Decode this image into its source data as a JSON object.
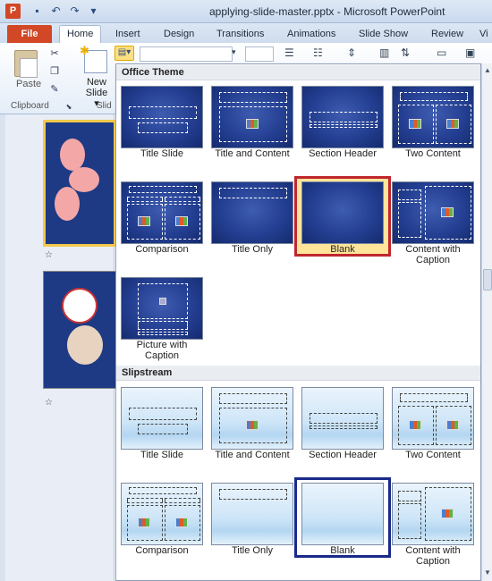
{
  "window": {
    "title": "applying-slide-master.pptx - Microsoft PowerPoint",
    "app_icon": "P"
  },
  "ribbon": {
    "file_tab": "File",
    "tabs": [
      "Home",
      "Insert",
      "Design",
      "Transitions",
      "Animations",
      "Slide Show",
      "Review",
      "Vi"
    ],
    "paste_label": "Paste",
    "new_slide_label_1": "New",
    "new_slide_label_2": "Slide ▾",
    "clipboard_group": "Clipboard",
    "slides_group": "Slid"
  },
  "gallery": {
    "sections": [
      {
        "title": "Office Theme",
        "theme": "office",
        "layouts": [
          {
            "label": "Title Slide",
            "label2": ""
          },
          {
            "label": "Title and Content",
            "label2": ""
          },
          {
            "label": "Section Header",
            "label2": ""
          },
          {
            "label": "Two Content",
            "label2": ""
          },
          {
            "label": "Comparison",
            "label2": ""
          },
          {
            "label": "Title Only",
            "label2": ""
          },
          {
            "label": "Blank",
            "label2": ""
          },
          {
            "label": "Content with",
            "label2": "Caption"
          },
          {
            "label": "Picture with",
            "label2": "Caption"
          }
        ]
      },
      {
        "title": "Slipstream",
        "theme": "slip",
        "layouts": [
          {
            "label": "Title Slide",
            "label2": ""
          },
          {
            "label": "Title and Content",
            "label2": ""
          },
          {
            "label": "Section Header",
            "label2": ""
          },
          {
            "label": "Two Content",
            "label2": ""
          },
          {
            "label": "Comparison",
            "label2": ""
          },
          {
            "label": "Title Only",
            "label2": ""
          },
          {
            "label": "Blank",
            "label2": ""
          },
          {
            "label": "Content with",
            "label2": "Caption"
          }
        ]
      }
    ]
  },
  "slides_pane": {
    "star_marks": [
      "☆",
      "☆"
    ]
  },
  "colors": {
    "file_tab": "#d24726",
    "selected_highlight": "#ffe49a",
    "highlight_outline_red": "#c0262d",
    "highlight_outline_blue": "#1a2a8a"
  }
}
